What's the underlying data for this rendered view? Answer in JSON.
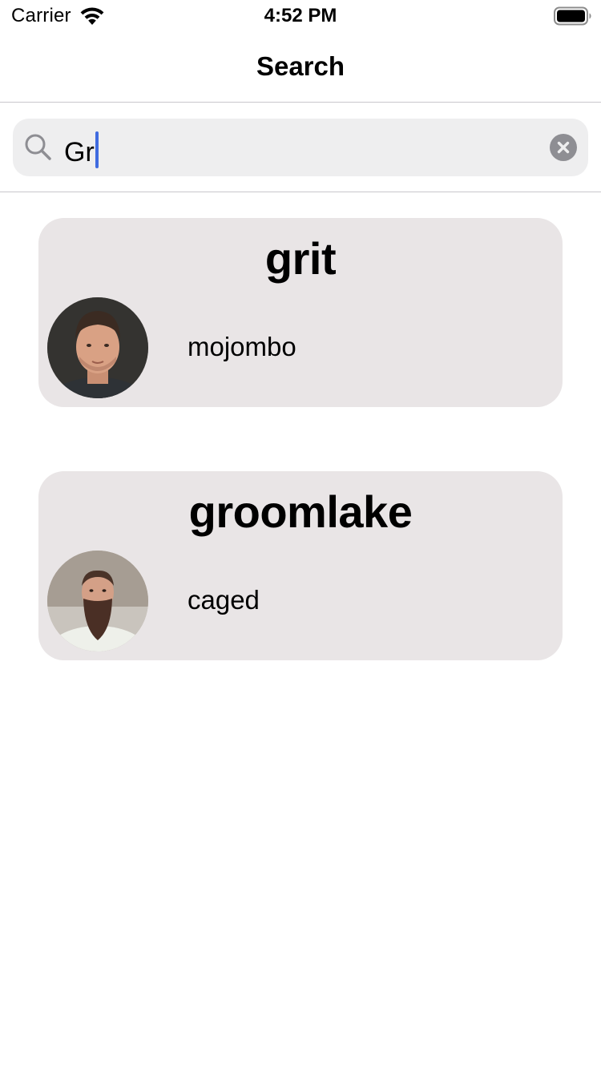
{
  "status_bar": {
    "carrier": "Carrier",
    "time": "4:52 PM"
  },
  "nav": {
    "title": "Search"
  },
  "search": {
    "value": "Gr"
  },
  "results": [
    {
      "name": "grit",
      "owner": "mojombo"
    },
    {
      "name": "groomlake",
      "owner": "caged"
    }
  ],
  "colors": {
    "card_background": "#e9e5e6",
    "search_background": "#eeeeef",
    "caret": "#3f6be0"
  },
  "icons": {
    "wifi": "wifi-icon",
    "battery": "battery-icon",
    "search": "magnifying-glass-icon",
    "clear": "clear-x-icon"
  }
}
